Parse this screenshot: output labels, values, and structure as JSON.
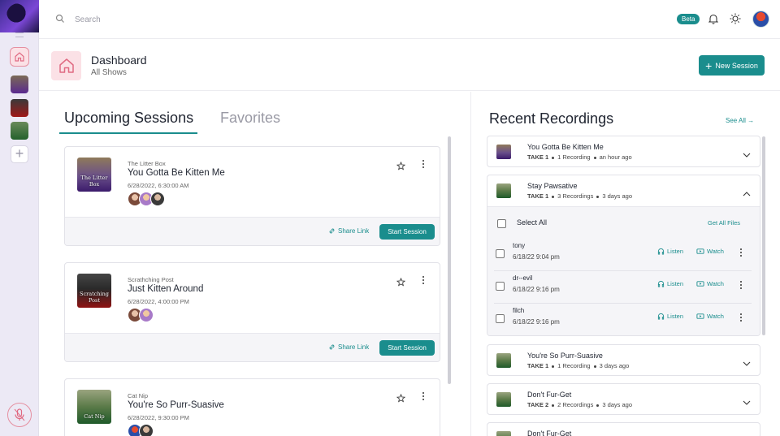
{
  "topbar": {
    "search_placeholder": "Search",
    "beta": "Beta"
  },
  "header": {
    "title": "Dashboard",
    "subtitle": "All Shows",
    "new_session": "New Session"
  },
  "tabs": {
    "upcoming": "Upcoming Sessions",
    "favorites": "Favorites"
  },
  "sessions": [
    {
      "show": "The Litter Box",
      "title": "You Gotta Be Kitten Me",
      "date": "6/28/2022, 6:30:00 AM",
      "thumb_text": "The Litter Box",
      "share": "Share Link",
      "start": "Start Session"
    },
    {
      "show": "Scrathching Post",
      "title": "Just Kitten Around",
      "date": "6/28/2022, 4:00:00 PM",
      "thumb_text": "Scratching Post",
      "share": "Share Link",
      "start": "Start Session"
    },
    {
      "show": "Cat Nip",
      "title": "You're So Purr-Suasive",
      "date": "6/28/2022, 9:30:00 PM",
      "thumb_text": "Cat Nip"
    }
  ],
  "recordings": {
    "title": "Recent Recordings",
    "see_all": "See All",
    "items": [
      {
        "title": "You Gotta Be Kitten Me",
        "take": "TAKE 1",
        "count": "1 Recording",
        "time": "an hour ago"
      },
      {
        "title": "Stay Pawsative",
        "take": "TAKE 1",
        "count": "3 Recordings",
        "time": "3 days ago"
      },
      {
        "title": "You're So Purr-Suasive",
        "take": "TAKE 1",
        "count": "1 Recording",
        "time": "3 days ago"
      },
      {
        "title": "Don't Fur-Get",
        "take": "TAKE 2",
        "count": "2 Recordings",
        "time": "3 days ago"
      },
      {
        "title": "Don't Fur-Get"
      }
    ],
    "select_all": "Select All",
    "get_all_files": "Get All Files",
    "listen": "Listen",
    "watch": "Watch",
    "files": [
      {
        "name": "tony",
        "date": "6/18/22 9:04 pm"
      },
      {
        "name": "dr--evil",
        "date": "6/18/22 9:16 pm"
      },
      {
        "name": "filch",
        "date": "6/18/22 9:16 pm"
      }
    ]
  },
  "colors": {
    "accent": "#1a8d8d",
    "home_tint": "#fbe1e6",
    "rail": "#ece9f5"
  }
}
